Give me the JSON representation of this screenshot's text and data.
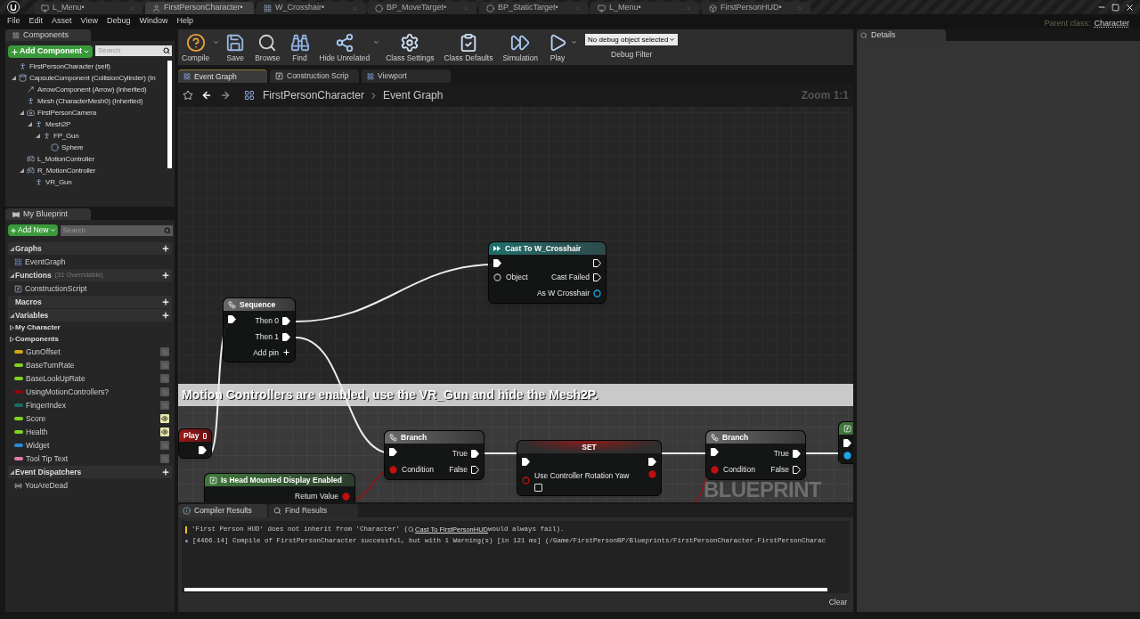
{
  "document_tabs": [
    {
      "label": "L_Menu•",
      "kind": "level",
      "selected": false
    },
    {
      "label": "FirstPersonCharacter•",
      "kind": "blueprint",
      "selected": true
    },
    {
      "label": "W_Crosshair•",
      "kind": "widget",
      "selected": false
    },
    {
      "label": "BP_MoveTarget•",
      "kind": "sphere",
      "selected": false
    },
    {
      "label": "BP_StaticTarget•",
      "kind": "sphere",
      "selected": false
    },
    {
      "label": "L_Menu•",
      "kind": "level",
      "selected": false
    },
    {
      "label": "FirstPersonHUD•",
      "kind": "hud",
      "selected": false
    }
  ],
  "parent_class": {
    "label": "Parent class:",
    "value": "Character"
  },
  "menu": [
    "File",
    "Edit",
    "Asset",
    "View",
    "Debug",
    "Window",
    "Help"
  ],
  "components_panel": {
    "title": "Components",
    "add_button": "Add Component",
    "search": {
      "placeholder": "Search"
    },
    "tree": [
      {
        "label": "FirstPersonCharacter (self)",
        "kind": "pawn"
      },
      {
        "label": "CapsuleComponent (CollisionCylinder) (In",
        "kind": "capsule",
        "children": [
          {
            "label": "ArrowComponent (Arrow) (Inherited)",
            "kind": "arrow"
          },
          {
            "label": "Mesh (CharacterMesh0) (Inherited)",
            "kind": "mesh"
          },
          {
            "label": "FirstPersonCamera",
            "kind": "camera",
            "children": [
              {
                "label": "Mesh2P",
                "kind": "mesh",
                "children": [
                  {
                    "label": "FP_Gun",
                    "kind": "mesh",
                    "children": [
                      {
                        "label": "Sphere",
                        "kind": "sphere"
                      }
                    ]
                  }
                ]
              }
            ]
          },
          {
            "label": "L_MotionController",
            "kind": "controller"
          },
          {
            "label": "R_MotionController",
            "kind": "controller",
            "children": [
              {
                "label": "VR_Gun",
                "kind": "mesh"
              }
            ]
          }
        ]
      }
    ]
  },
  "my_blueprint": {
    "title": "My Blueprint",
    "add_button": "Add New",
    "search": {
      "placeholder": "Search"
    },
    "sections": [
      {
        "title": "Graphs",
        "items": [
          {
            "label": "EventGraph",
            "kind": "graph"
          }
        ]
      },
      {
        "title": "Functions",
        "note": "(31 Overridable)",
        "items": [
          {
            "label": "ConstructionScript",
            "kind": "function"
          }
        ]
      },
      {
        "title": "Macros"
      },
      {
        "title": "Variables",
        "categories": [
          "My Character",
          "Components"
        ],
        "items": [
          {
            "label": "GunOffset",
            "kind": "variable",
            "color": "#d6a51c",
            "public": false
          },
          {
            "label": "BaseTurnRate",
            "kind": "variable",
            "color": "#7fd321",
            "public": false
          },
          {
            "label": "BaseLookUpRate",
            "kind": "variable",
            "color": "#7fd321",
            "public": false
          },
          {
            "label": "UsingMotionControllers?",
            "kind": "variable",
            "color": "#8c0a0a",
            "public": false
          },
          {
            "label": "FingerIndex",
            "kind": "variable",
            "color": "#1b6e68",
            "public": false
          },
          {
            "label": "Score",
            "kind": "variable",
            "color": "#7fd321",
            "public": true
          },
          {
            "label": "Health",
            "kind": "variable",
            "color": "#7fd321",
            "public": true
          },
          {
            "label": "Widget",
            "kind": "variable",
            "color": "#2a8ad6",
            "public": false
          },
          {
            "label": "Tool Tip Text",
            "kind": "variable",
            "color": "#e07aa8",
            "public": false
          }
        ]
      },
      {
        "title": "Event Dispatchers",
        "items": [
          {
            "label": "YouAreDead",
            "kind": "dispatcher"
          }
        ]
      }
    ]
  },
  "toolbar": [
    {
      "label": "Compile",
      "kind": "compile",
      "menu": true
    },
    {
      "label": "Save",
      "kind": "save"
    },
    {
      "label": "Browse",
      "kind": "browse"
    },
    {
      "label": "Find",
      "kind": "find"
    },
    {
      "label": "Hide Unrelated",
      "kind": "hide",
      "menu": true
    },
    {
      "label": "Class Settings",
      "kind": "settings"
    },
    {
      "label": "Class Defaults",
      "kind": "defaults"
    },
    {
      "label": "Simulation",
      "kind": "simulation"
    },
    {
      "label": "Play",
      "kind": "play",
      "menu": true
    }
  ],
  "debug_filter": {
    "value": "No debug object selected",
    "label": "Debug Filter"
  },
  "graph_tabs": [
    {
      "label": "Event Graph",
      "kind": "graph",
      "selected": true
    },
    {
      "label": "Construction Scrip",
      "kind": "function",
      "selected": false
    },
    {
      "label": "Viewport",
      "kind": "viewport",
      "selected": false
    }
  ],
  "graph": {
    "breadcrumb": [
      "FirstPersonCharacter",
      "Event Graph"
    ],
    "zoom": "Zoom 1:1",
    "watermark": "BLUEPRINT",
    "comment": "Motion Controllers are enabled, use the VR_Gun and hide the Mesh2P.",
    "nodes": [
      {
        "kind": "cast",
        "title": "Cast To W_Crosshair",
        "rows": [
          {
            "left": {
              "kind": "exec",
              "connected": true
            },
            "right": {
              "kind": "exec",
              "connected": false
            }
          },
          {
            "left": {
              "kind": "data",
              "label": "Object",
              "color": "#a8a8a8",
              "connected": false
            },
            "right": {
              "kind": "exec",
              "label": "Cast Failed",
              "connected": false
            }
          },
          {
            "right": {
              "kind": "data",
              "label": "As W Crosshair",
              "color": "#1ea6e6",
              "connected": false
            }
          }
        ]
      },
      {
        "kind": "sequence",
        "title": "Sequence",
        "rows": [
          {
            "left": {
              "kind": "exec",
              "connected": true
            },
            "right": {
              "kind": "exec",
              "label": "Then 0",
              "connected": true
            }
          },
          {
            "right": {
              "kind": "exec",
              "label": "Then 1",
              "connected": true
            }
          },
          {
            "right": {
              "kind": "add",
              "label": "Add pin"
            }
          }
        ]
      },
      {
        "kind": "event",
        "title": "Play",
        "rows": [
          {
            "right": {
              "kind": "exec",
              "connected": true
            }
          }
        ]
      },
      {
        "kind": "branch",
        "title": "Branch",
        "rows": [
          {
            "left": {
              "kind": "exec",
              "connected": true
            },
            "right": {
              "kind": "exec",
              "label": "True",
              "connected": true
            }
          },
          {
            "left": {
              "kind": "data",
              "label": "Condition",
              "color": "#c01010",
              "connected": true
            },
            "right": {
              "kind": "exec",
              "label": "False",
              "connected": false
            }
          }
        ]
      },
      {
        "kind": "set",
        "title": "SET",
        "rows": [
          {
            "left": {
              "kind": "exec",
              "connected": true
            },
            "right": {
              "kind": "exec",
              "connected": true
            }
          },
          {
            "left": {
              "kind": "data",
              "label": "Use Controller Rotation Yaw",
              "color": "#c01010",
              "connected": false,
              "checked": false
            },
            "right": {
              "kind": "data",
              "color": "#c01010",
              "connected": true
            }
          }
        ]
      },
      {
        "kind": "branch",
        "title": "Branch",
        "rows": [
          {
            "left": {
              "kind": "exec",
              "connected": true
            },
            "right": {
              "kind": "exec",
              "label": "True",
              "connected": true
            }
          },
          {
            "left": {
              "kind": "data",
              "label": "Condition",
              "color": "#c01010",
              "connected": true
            },
            "right": {
              "kind": "exec",
              "label": "False",
              "connected": false
            }
          }
        ]
      },
      {
        "kind": "function",
        "rows": [
          {
            "left": {
              "kind": "exec",
              "connected": true
            }
          },
          {
            "left": {
              "kind": "data",
              "color": "#1ea6e6",
              "connected": true
            }
          }
        ]
      },
      {
        "kind": "function",
        "title": "Is Head Mounted Display Enabled",
        "rows": [
          {
            "right": {
              "kind": "data",
              "label": "Return Value",
              "color": "#c01010",
              "connected": true
            }
          }
        ]
      }
    ]
  },
  "results": {
    "tabs": [
      {
        "label": "Compiler Results",
        "kind": "compiler",
        "selected": true
      },
      {
        "label": "Find Results",
        "kind": "find",
        "selected": false
      }
    ],
    "messages": [
      {
        "kind": "warning",
        "text": "'First Person HUD' does not inherit from 'Character' (",
        "link": "Cast To FirstPersonHUD",
        "text_after": " would always fail)."
      },
      {
        "kind": "info",
        "text": "[4466.14] Compile of FirstPersonCharacter successful, but with 1 Warning(s) [in 121 ms] (/Game/FirstPersonBP/Blueprints/FirstPersonCharacter.FirstPersonCharac"
      }
    ],
    "clear_button": "Clear"
  },
  "details": {
    "title": "Details"
  }
}
